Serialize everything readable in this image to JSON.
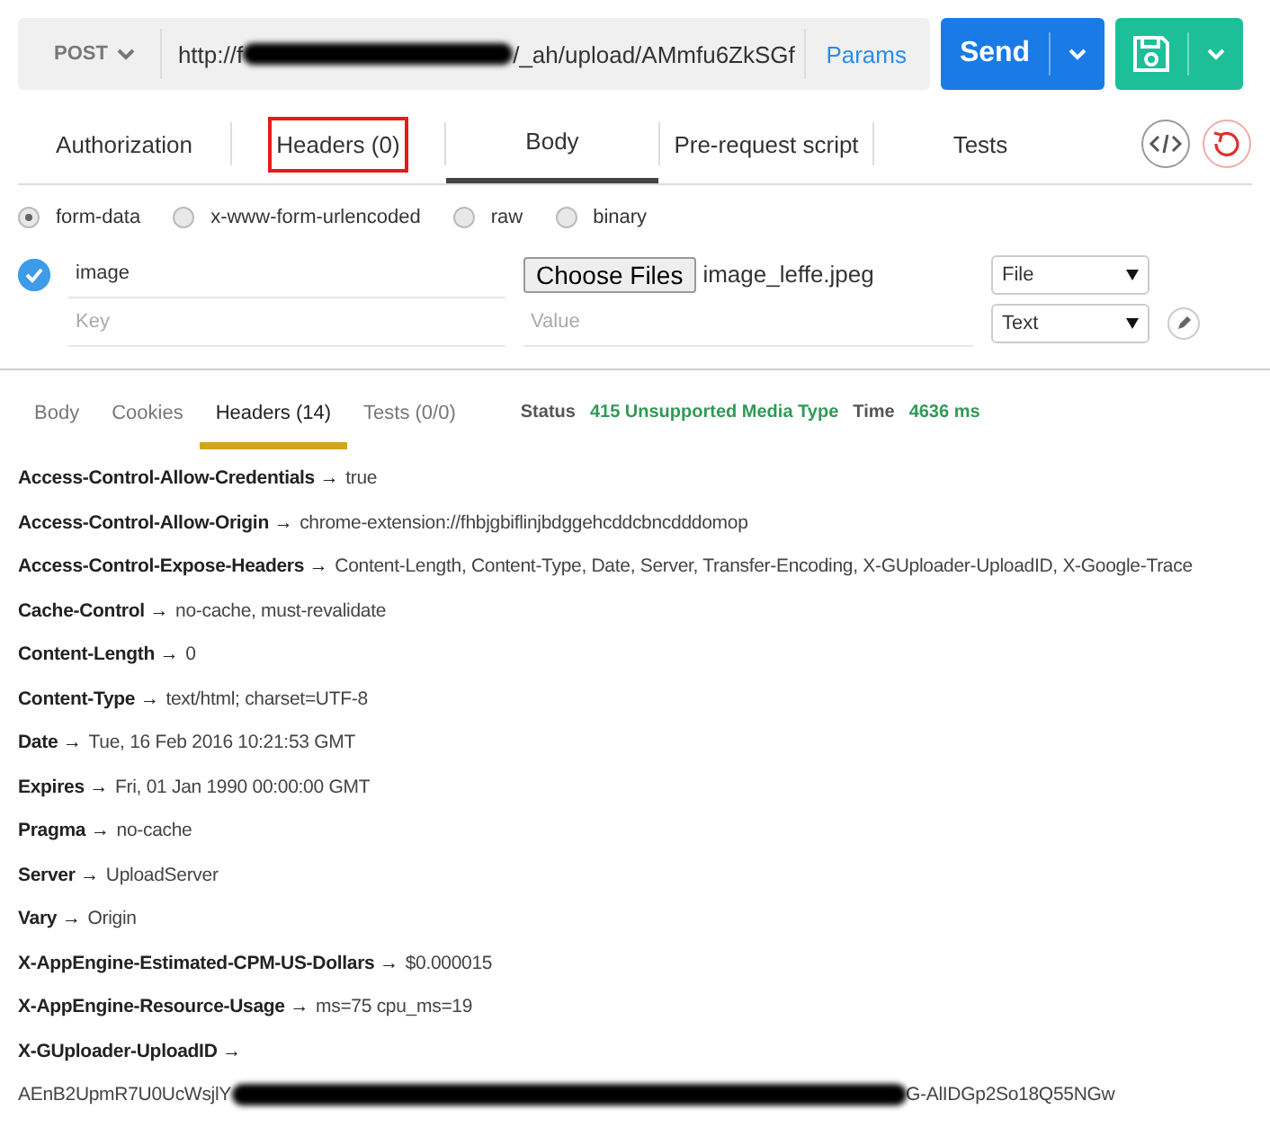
{
  "request_bar": {
    "method": "POST",
    "url_start": "http://f",
    "url_end": "/_ah/upload/AMmfu6ZkSGf",
    "params": "Params",
    "send": "Send"
  },
  "request_tabs": [
    {
      "label": "Authorization",
      "selected": false,
      "highlighted": false
    },
    {
      "label": "Headers (0)",
      "selected": false,
      "highlighted": true
    },
    {
      "label": "Body",
      "selected": true,
      "highlighted": false
    },
    {
      "label": "Pre-request script",
      "selected": false,
      "highlighted": false
    },
    {
      "label": "Tests",
      "selected": false,
      "highlighted": false
    }
  ],
  "body_types": [
    {
      "label": "form-data",
      "selected": true
    },
    {
      "label": "x-www-form-urlencoded",
      "selected": false
    },
    {
      "label": "raw",
      "selected": false
    },
    {
      "label": "binary",
      "selected": false
    }
  ],
  "form_rows": [
    {
      "key": "image",
      "checked": true,
      "kind": "file",
      "choose": "Choose Files",
      "file_name": "image_leffe.jpeg",
      "type": "File"
    },
    {
      "key_placeholder": "Key",
      "checked": false,
      "kind": "text",
      "value_placeholder": "Value",
      "type": "Text"
    }
  ],
  "response_tabs": [
    {
      "label": "Body",
      "selected": false
    },
    {
      "label": "Cookies",
      "selected": false
    },
    {
      "label": "Headers (14)",
      "selected": true
    },
    {
      "label": "Tests (0/0)",
      "selected": false
    }
  ],
  "status": {
    "label": "Status",
    "value": "415 Unsupported Media Type",
    "time_label": "Time",
    "time_value": "4636 ms"
  },
  "headers": [
    {
      "name": "Access-Control-Allow-Credentials →",
      "value": "true"
    },
    {
      "name": "Access-Control-Allow-Origin →",
      "value": "chrome-extension://fhbjgbiflinjbdggehcddcbncdddomop"
    },
    {
      "name": "Access-Control-Expose-Headers →",
      "value": "Content-Length, Content-Type, Date, Server, Transfer-Encoding, X-GUploader-UploadID, X-Google-Trace"
    },
    {
      "name": "Cache-Control →",
      "value": "no-cache, must-revalidate"
    },
    {
      "name": "Content-Length →",
      "value": "0"
    },
    {
      "name": "Content-Type →",
      "value": "text/html; charset=UTF-8"
    },
    {
      "name": "Date →",
      "value": "Tue, 16 Feb 2016 10:21:53 GMT"
    },
    {
      "name": "Expires →",
      "value": "Fri, 01 Jan 1990 00:00:00 GMT"
    },
    {
      "name": "Pragma →",
      "value": "no-cache"
    },
    {
      "name": "Server →",
      "value": "UploadServer"
    },
    {
      "name": "Vary →",
      "value": "Origin"
    },
    {
      "name": "X-AppEngine-Estimated-CPM-US-Dollars →",
      "value": "$0.000015"
    },
    {
      "name": "X-AppEngine-Resource-Usage →",
      "value": "ms=75 cpu_ms=19"
    },
    {
      "name": "X-GUploader-UploadID →",
      "value": "AEnB2UpmR7U0UcWsjlY",
      "value_end": "G-AlIDGp2So18Q55NGw"
    }
  ]
}
